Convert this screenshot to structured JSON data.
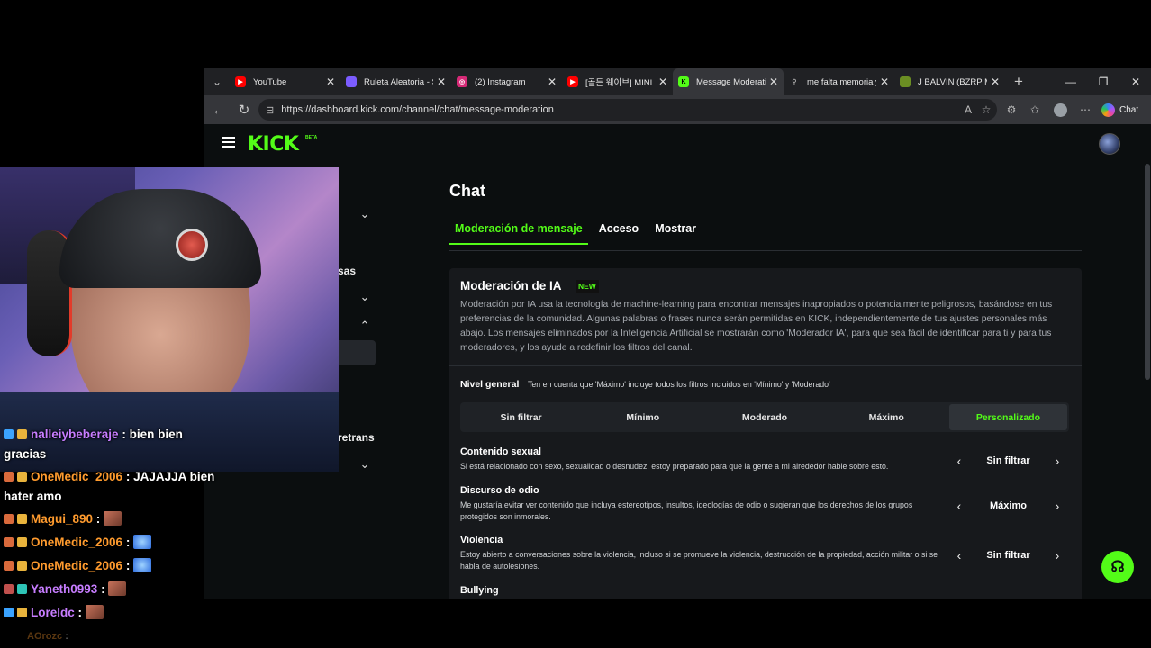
{
  "browser": {
    "tabs": [
      {
        "title": "YouTube",
        "fav_color": "#ff0000",
        "fav": "youtube-icon"
      },
      {
        "title": "Ruleta Aleatoria - S",
        "fav_color": "#7b5cff",
        "fav": "roulette-icon"
      },
      {
        "title": "(2) Instagram",
        "fav_color": "#d62976",
        "fav": "instagram-icon"
      },
      {
        "title": "[골든 웨이브] MINI",
        "fav_color": "#ff0000",
        "fav": "youtube-icon"
      },
      {
        "title": "Message Moderati",
        "fav_color": "#53fc18",
        "fav": "kick-icon",
        "active": true
      },
      {
        "title": "me falta memoria y",
        "fav_color": "#5f6368",
        "fav": "search-icon"
      },
      {
        "title": "J BALVIN (BZRP M.",
        "fav_color": "#6b8e23",
        "fav": "page-icon"
      }
    ],
    "url": "https://dashboard.kick.com/channel/chat/message-moderation",
    "chat_button": "Chat"
  },
  "kick": {
    "logo": "KICK",
    "beta": "BETA",
    "sidebar_partial": [
      "sas",
      "retrans"
    ],
    "page_title": "Chat",
    "tabs": [
      "Moderación de mensaje",
      "Acceso",
      "Mostrar"
    ],
    "ai": {
      "title": "Moderación de IA",
      "badge": "NEW",
      "description": "Moderación por IA usa la tecnología de machine-learning para encontrar mensajes inapropiados o potencialmente peligrosos, basándose en tus preferencias de la comunidad. Algunas palabras o frases nunca serán permitidas en KICK, independientemente de tus ajustes personales más abajo. Los mensajes eliminados por la Inteligencia Artificial se mostrarán como 'Moderador IA', para que sea fácil de identificar para ti y para tus moderadores, y los ayude a redefinir los filtros del canal."
    },
    "nivel": {
      "label": "Nivel general",
      "note": "Ten en cuenta que 'Máximo' incluye todos los filtros incluidos en 'Mínimo' y 'Moderado'",
      "options": [
        "Sin filtrar",
        "Mínimo",
        "Moderado",
        "Máximo",
        "Personalizado"
      ],
      "selected": "Personalizado"
    },
    "categories": [
      {
        "title": "Contenido sexual",
        "desc": "Si está relacionado con sexo, sexualidad o desnudez, estoy preparado para que la gente a mi alrededor hable sobre esto.",
        "value": "Sin filtrar"
      },
      {
        "title": "Discurso de odio",
        "desc": "Me gustaría evitar ver contenido que incluya estereotipos, insultos, ideologías de odio o sugieran que los derechos de los grupos protegidos son inmorales.",
        "value": "Máximo"
      },
      {
        "title": "Violencia",
        "desc": "Estoy abierto a conversaciones sobre la violencia, incluso si se promueve la violencia, destrucción de la propiedad, acción militar o si se habla de autolesiones.",
        "value": "Sin filtrar"
      },
      {
        "title": "Bullying",
        "desc": "",
        "value": ""
      }
    ]
  },
  "stream_chat": [
    {
      "user": "nalleiybeberaje",
      "msg": ": bien bien",
      "cont": "gracias",
      "color": "purple"
    },
    {
      "user": "OneMedic_2006",
      "msg": ": JAJAJJA bien",
      "cont": "hater amo",
      "color": "orange"
    },
    {
      "user": "Magui_890",
      "msg": ":",
      "color": "orange",
      "emote": "face-emote"
    },
    {
      "user": "OneMedic_2006",
      "msg": ":",
      "color": "orange",
      "emote": "butterfly-emote"
    },
    {
      "user": "OneMedic_2006",
      "msg": ":",
      "color": "orange",
      "emote": "butterfly-emote"
    },
    {
      "user": "Yaneth0993",
      "msg": ":",
      "color": "purple",
      "emote": "face-emote"
    },
    {
      "user": "Loreldc",
      "msg": ":",
      "color": "purple",
      "emote": "face-emote"
    },
    {
      "user": "AOrozc",
      "msg": ":",
      "color": "faded"
    }
  ],
  "colors": {
    "kick_green": "#53fc18",
    "panel": "#17191c",
    "bg": "#0b0e0f"
  }
}
